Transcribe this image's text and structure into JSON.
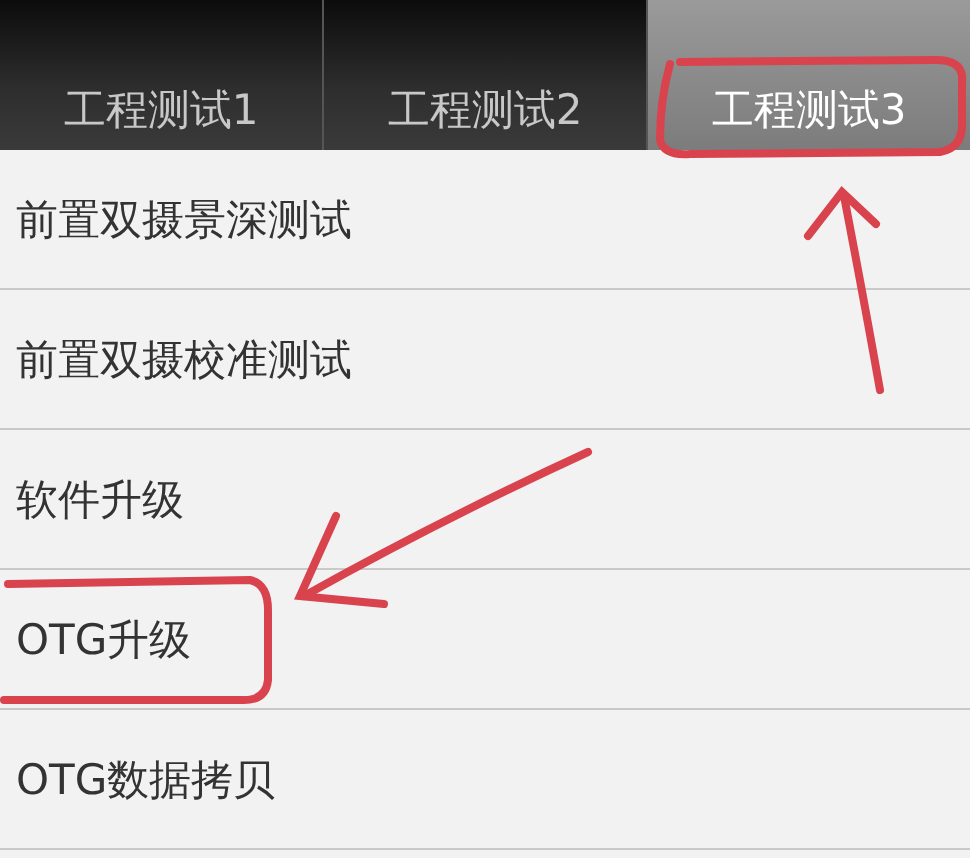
{
  "tabs": [
    {
      "label": "工程测试1",
      "selected": false
    },
    {
      "label": "工程测试2",
      "selected": false
    },
    {
      "label": "工程测试3",
      "selected": true
    }
  ],
  "items": [
    {
      "label": "前置双摄景深测试"
    },
    {
      "label": "前置双摄校准测试"
    },
    {
      "label": "软件升级"
    },
    {
      "label": "OTG升级"
    },
    {
      "label": "OTG数据拷贝"
    }
  ]
}
